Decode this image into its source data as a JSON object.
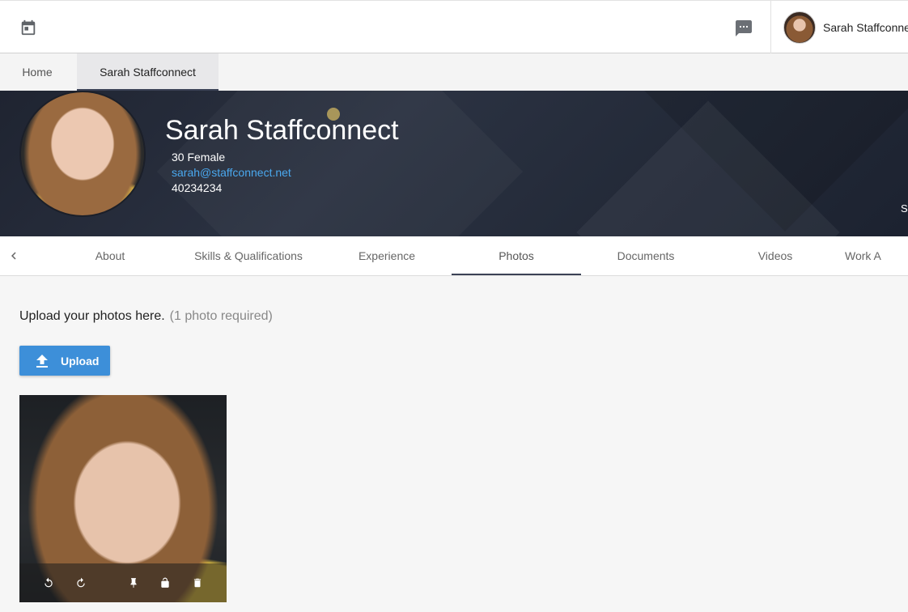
{
  "topbar": {
    "calendar_icon": "calendar-icon",
    "chat_icon": "chat-icon",
    "user_name": "Sarah Staffconne"
  },
  "page_tabs": [
    {
      "label": "Home"
    },
    {
      "label": "Sarah Staffconnect"
    }
  ],
  "profile": {
    "name": "Sarah Staffconnect",
    "age_gender": "30 Female",
    "email": "sarah@staffconnect.net",
    "phone": "40234234",
    "edge_text": "S",
    "accent_dot_color": "#a8965a"
  },
  "section_tabs": [
    {
      "label": "About"
    },
    {
      "label": "Skills & Qualifications"
    },
    {
      "label": "Experience"
    },
    {
      "label": "Photos"
    },
    {
      "label": "Documents"
    },
    {
      "label": "Videos"
    },
    {
      "label": "Work A"
    }
  ],
  "active_section": "Photos",
  "photos_section": {
    "intro": "Upload your photos here.",
    "required": "(1  photo required)",
    "upload_label": "Upload",
    "upload_color": "#3d8fd9",
    "tools": [
      "rotate-left-icon",
      "rotate-right-icon",
      "pin-icon",
      "unlock-icon",
      "trash-icon"
    ]
  }
}
